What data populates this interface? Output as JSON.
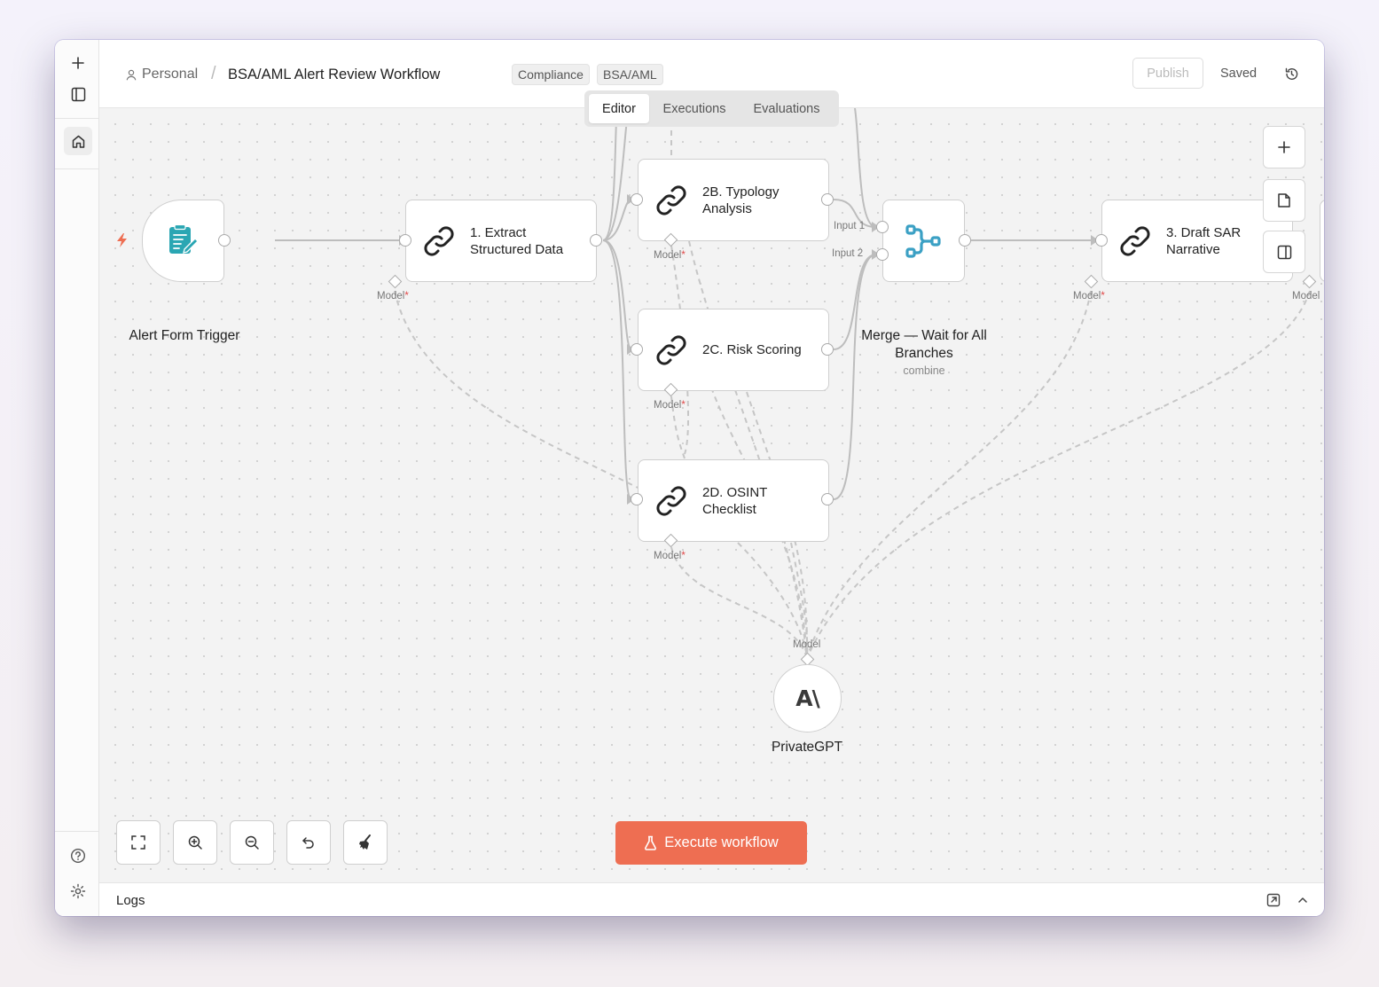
{
  "header": {
    "workspace": "Personal",
    "separator": "/",
    "workflow_title": "BSA/AML Alert Review Workflow",
    "tags": [
      "Compliance",
      "BSA/AML"
    ],
    "publish_label": "Publish",
    "saved_label": "Saved"
  },
  "tabs": [
    {
      "label": "Editor",
      "active": true
    },
    {
      "label": "Executions",
      "active": false
    },
    {
      "label": "Evaluations",
      "active": false
    }
  ],
  "nodes": {
    "trigger": {
      "label": "Alert Form Trigger"
    },
    "extract": {
      "label_line1": "1. Extract",
      "label_line2": "Structured Data",
      "port": "Model"
    },
    "typology": {
      "label_line1": "2B. Typology",
      "label_line2": "Analysis",
      "port": "Model"
    },
    "risk": {
      "label_line1": "2C. Risk Scoring",
      "port": "Model"
    },
    "osint": {
      "label_line1": "2D. OSINT",
      "label_line2": "Checklist",
      "port": "Model"
    },
    "merge": {
      "label_line1": "Merge — Wait for All",
      "label_line2": "Branches",
      "subtitle": "combine",
      "input1": "Input 1",
      "input2": "Input 2"
    },
    "draft": {
      "label_line1": "3. Draft SAR",
      "label_line2": "Narrative",
      "port": "Model"
    },
    "next": {
      "port": "Model"
    },
    "model": {
      "label": "PrivateGPT",
      "port": "Model",
      "glyph": "A\\"
    }
  },
  "required_marker": "*",
  "execute_label": "Execute workflow",
  "logs_label": "Logs",
  "colors": {
    "accent": "#ee6e52",
    "trigger_icon": "#2aa6b3",
    "merge_icon": "#3ba0c4",
    "bolt": "#ee6e52"
  },
  "icons": {
    "rail": [
      "plus-icon",
      "sidebar-toggle-icon",
      "home-icon",
      "help-icon",
      "settings-icon"
    ],
    "header": [
      "history-icon",
      "more-icon"
    ],
    "canvas_right": [
      "add-node-icon",
      "sticky-note-icon",
      "panel-toggle-icon"
    ],
    "canvas_bottom": [
      "fit-view-icon",
      "zoom-in-icon",
      "zoom-out-icon",
      "undo-icon",
      "clean-up-icon"
    ]
  }
}
